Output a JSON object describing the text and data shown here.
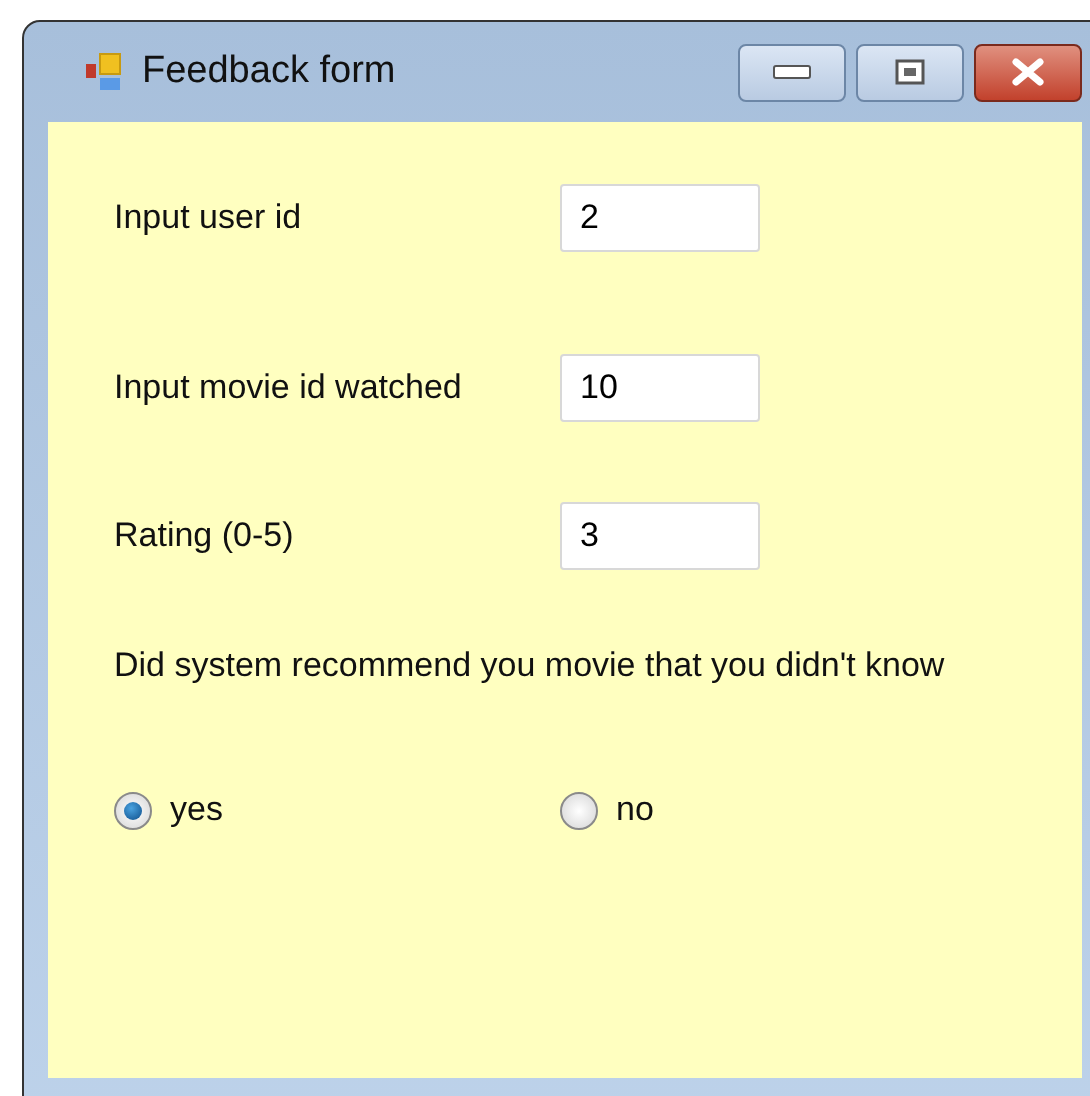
{
  "window": {
    "title": "Feedback form"
  },
  "fields": [
    {
      "label": "Input user id",
      "value": "2"
    },
    {
      "label": "Input movie id watched",
      "value": "10"
    },
    {
      "label": "Rating (0-5)",
      "value": "3"
    }
  ],
  "question": "Did system recommend you movie that you didn't know",
  "options": [
    {
      "label": "yes",
      "selected": true
    },
    {
      "label": "no",
      "selected": false
    }
  ]
}
